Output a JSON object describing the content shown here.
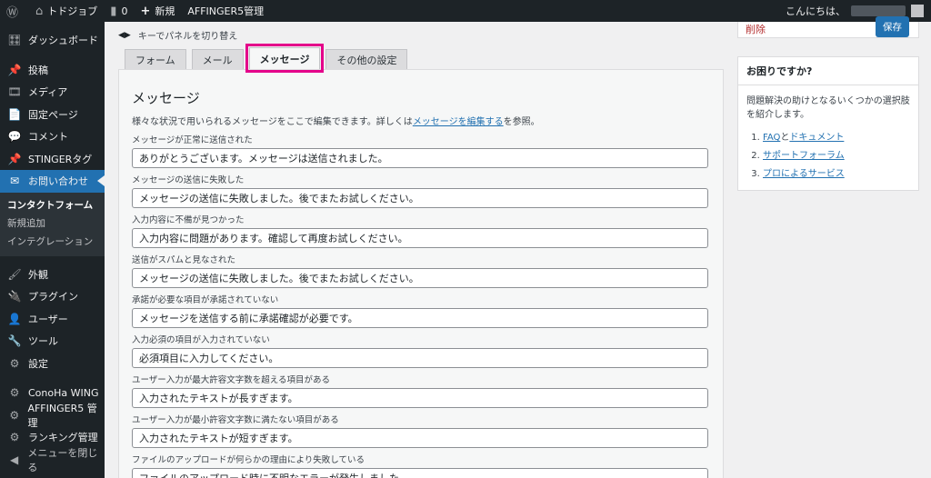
{
  "adminbar": {
    "site_name": "トドジョブ",
    "comments_count": "0",
    "new_label": "新規",
    "affinger_label": "AFFINGER5管理",
    "greeting": "こんにちは、"
  },
  "sidebar": {
    "items": [
      {
        "label": "ダッシュボード",
        "icon": "🎛"
      },
      {
        "label": "投稿",
        "icon": "📌"
      },
      {
        "label": "メディア",
        "icon": "🎞"
      },
      {
        "label": "固定ページ",
        "icon": "📄"
      },
      {
        "label": "コメント",
        "icon": "💬"
      },
      {
        "label": "STINGERタグ",
        "icon": "📌"
      },
      {
        "label": "お問い合わせ",
        "icon": "✉"
      }
    ],
    "submenu": [
      {
        "label": "コンタクトフォーム"
      },
      {
        "label": "新規追加"
      },
      {
        "label": "インテグレーション"
      }
    ],
    "items2": [
      {
        "label": "外観",
        "icon": "🖌"
      },
      {
        "label": "プラグイン",
        "icon": "🔌"
      },
      {
        "label": "ユーザー",
        "icon": "👤"
      },
      {
        "label": "ツール",
        "icon": "🔧"
      },
      {
        "label": "設定",
        "icon": "⚙"
      }
    ],
    "items3": [
      {
        "label": "ConoHa WING",
        "icon": "⚙"
      },
      {
        "label": "AFFINGER5 管理",
        "icon": "⚙"
      },
      {
        "label": "ランキング管理",
        "icon": "⚙"
      },
      {
        "label": "メニューを閉じる",
        "icon": "◀"
      }
    ]
  },
  "main": {
    "keyhint": "キーでパネルを切り替え",
    "tabs": [
      {
        "label": "フォーム"
      },
      {
        "label": "メール"
      },
      {
        "label": "メッセージ"
      },
      {
        "label": "その他の設定"
      }
    ],
    "panel": {
      "title": "メッセージ",
      "desc_before": "様々な状況で用いられるメッセージをここで編集できます。詳しくは",
      "desc_link": "メッセージを編集する",
      "desc_after": "を参照。",
      "fields": [
        {
          "label": "メッセージが正常に送信された",
          "value": "ありがとうございます。メッセージは送信されました。"
        },
        {
          "label": "メッセージの送信に失敗した",
          "value": "メッセージの送信に失敗しました。後でまたお試しください。"
        },
        {
          "label": "入力内容に不備が見つかった",
          "value": "入力内容に問題があります。確認して再度お試しください。"
        },
        {
          "label": "送信がスパムと見なされた",
          "value": "メッセージの送信に失敗しました。後でまたお試しください。"
        },
        {
          "label": "承諾が必要な項目が承諾されていない",
          "value": "メッセージを送信する前に承諾確認が必要です。"
        },
        {
          "label": "入力必須の項目が入力されていない",
          "value": "必須項目に入力してください。"
        },
        {
          "label": "ユーザー入力が最大許容文字数を超える項目がある",
          "value": "入力されたテキストが長すぎます。"
        },
        {
          "label": "ユーザー入力が最小許容文字数に満たない項目がある",
          "value": "入力されたテキストが短すぎます。"
        },
        {
          "label": "ファイルのアップロードが何らかの理由により失敗している",
          "value": "ファイルのアップロード時に不明なエラーが発生しました。"
        }
      ]
    }
  },
  "right": {
    "delete_label": "削除",
    "save_label": "保存",
    "help": {
      "title": "お困りですか?",
      "text": "問題解決の助けとなるいくつかの選択肢を紹介します。",
      "item1_link1": "FAQ",
      "item1_and": "と",
      "item1_link2": "ドキュメント",
      "item2_link": "サポートフォーラム",
      "item3_link": "プロによるサービス"
    }
  }
}
